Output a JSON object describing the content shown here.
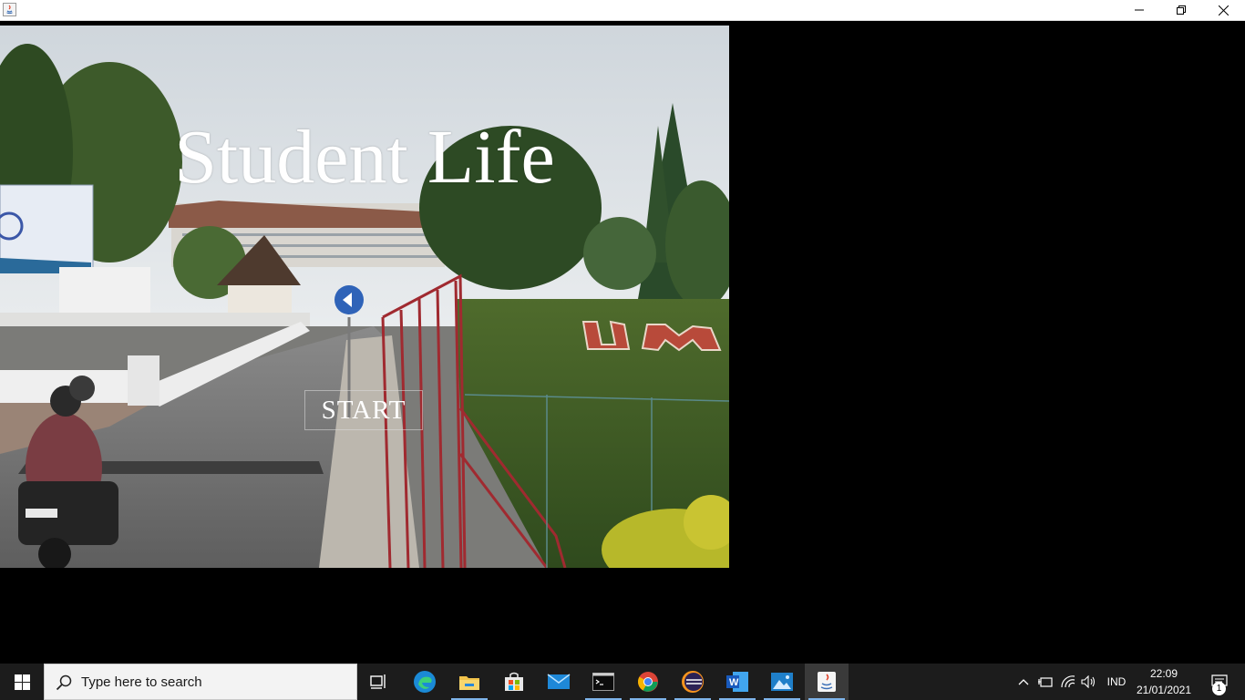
{
  "window": {
    "app_icon": "java-icon",
    "controls": [
      "minimize-icon",
      "restore-icon",
      "close-icon"
    ]
  },
  "app": {
    "title": "Student Life",
    "start_label": "START",
    "background_scene": "campus-gate-photo"
  },
  "taskbar": {
    "start_icon": "windows-logo-icon",
    "search_placeholder": "Type here to search",
    "apps": [
      {
        "name": "task-view-icon",
        "running": false
      },
      {
        "name": "edge-icon",
        "running": false
      },
      {
        "name": "file-explorer-icon",
        "running": true
      },
      {
        "name": "microsoft-store-icon",
        "running": false
      },
      {
        "name": "mail-icon",
        "running": false
      },
      {
        "name": "command-prompt-icon",
        "running": true
      },
      {
        "name": "chrome-icon",
        "running": true
      },
      {
        "name": "eclipse-icon",
        "running": true
      },
      {
        "name": "word-icon",
        "running": true
      },
      {
        "name": "photos-icon",
        "running": true
      },
      {
        "name": "java-icon",
        "running": true,
        "active": true
      }
    ],
    "tray": {
      "language": "IND",
      "time": "22:09",
      "date": "21/01/2021",
      "notification_count": "1"
    }
  },
  "colors": {
    "taskbar_bg": "#1c1c1c",
    "running_indicator": "#7eb4ea",
    "title_text": "#ffffff",
    "outer_bg": "#000000"
  }
}
